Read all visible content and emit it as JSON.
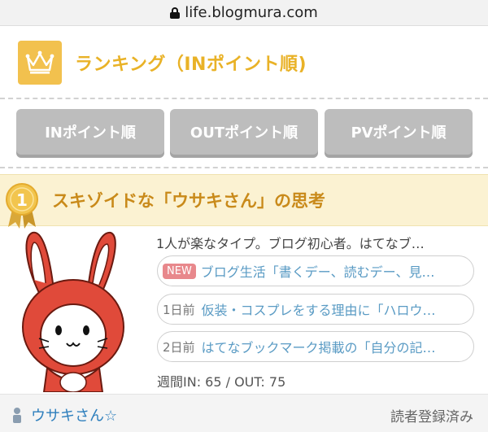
{
  "browser": {
    "url": "life.blogmura.com"
  },
  "ranking": {
    "title": "ランキング（INポイント順)"
  },
  "sort_tabs": [
    {
      "label": "INポイント順"
    },
    {
      "label": "OUTポイント順"
    },
    {
      "label": "PVポイント順"
    }
  ],
  "entry": {
    "rank": "1",
    "blog_title": "スキゾイドな「ウサキさん」の思考",
    "description": "1人が楽なタイプ。ブログ初心者。はてなブ…",
    "posts": [
      {
        "badge": "NEW",
        "when": "",
        "title": "ブログ生活「書くデー、読むデー、見…"
      },
      {
        "badge": "",
        "when": "1日前",
        "title": "仮装・コスプレをする理由に「ハロウ…"
      },
      {
        "badge": "",
        "when": "2日前",
        "title": "はてなブックマーク掲載の「自分の記…"
      }
    ],
    "stats": "週間IN: 65  /  OUT: 75",
    "author": "ウサキさん☆",
    "reader_status": "読者登録済み"
  },
  "colors": {
    "accent": "#e9b227",
    "link": "#5a9bc4",
    "tab_bg": "#bdbdbd",
    "entry_bg": "#fbf2d2"
  }
}
